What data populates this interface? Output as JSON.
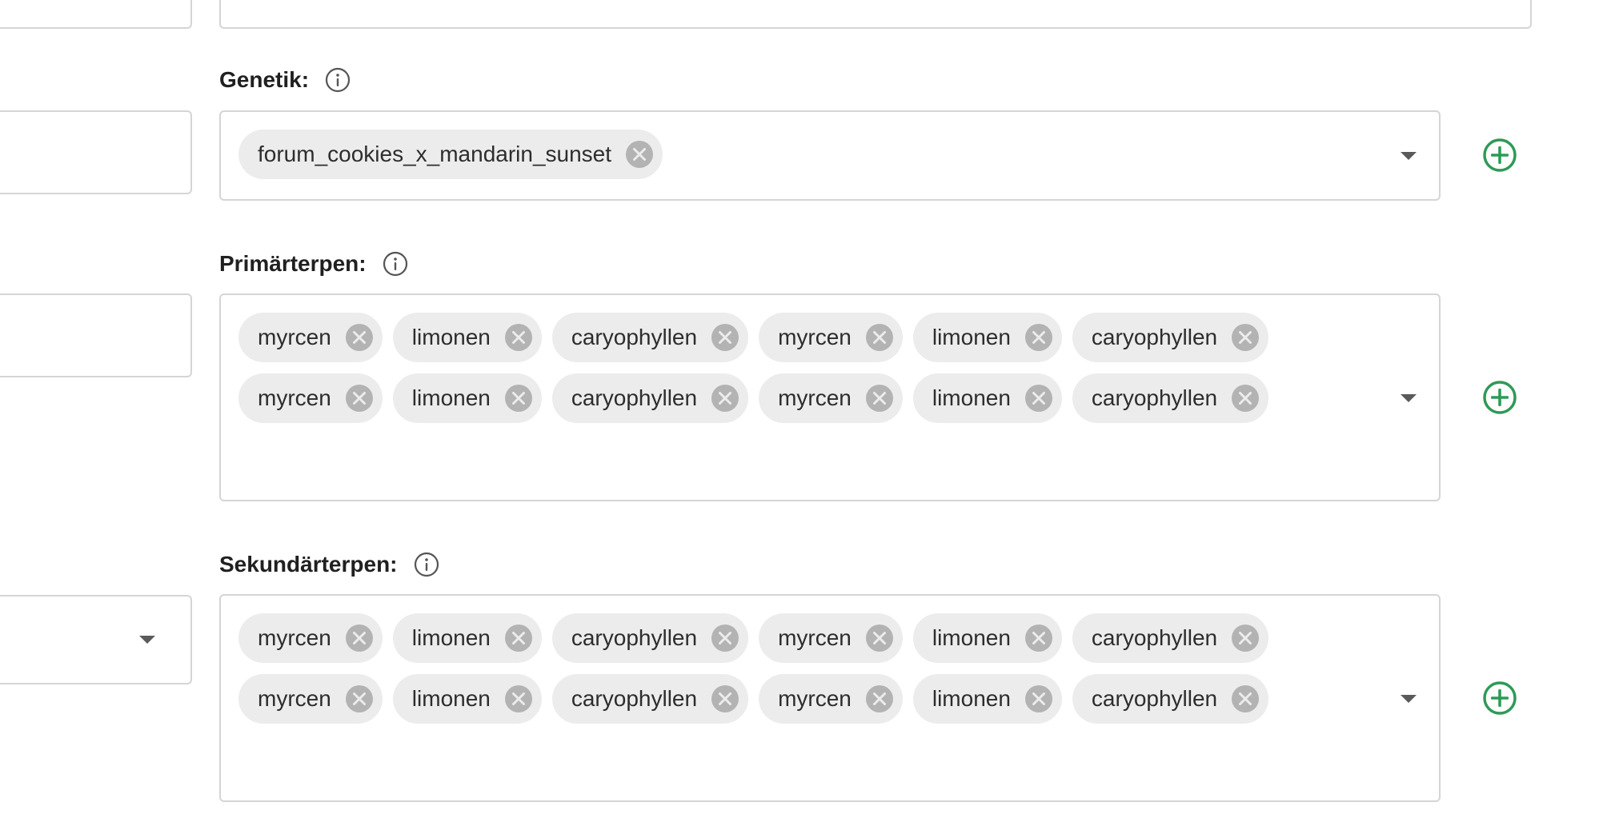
{
  "colors": {
    "accent_green": "#2e9a57",
    "chip_bg": "#ececec",
    "border": "#d5d5d5"
  },
  "sections": [
    {
      "label": "Genetik:",
      "tags": [
        "forum_cookies_x_mandarin_sunset"
      ]
    },
    {
      "label": "Primärterpen:",
      "tags": [
        "myrcen",
        "limonen",
        "caryophyllen",
        "myrcen",
        "limonen",
        "caryophyllen",
        "myrcen",
        "limonen",
        "caryophyllen",
        "myrcen",
        "limonen",
        "caryophyllen"
      ]
    },
    {
      "label": "Sekundärterpen:",
      "tags": [
        "myrcen",
        "limonen",
        "caryophyllen",
        "myrcen",
        "limonen",
        "caryophyllen",
        "myrcen",
        "limonen",
        "caryophyllen",
        "myrcen",
        "limonen",
        "caryophyllen"
      ]
    }
  ],
  "icons": {
    "info": "info-circle-icon",
    "remove": "close-circle-icon",
    "dropdown": "caret-down-icon",
    "add": "plus-circle-icon"
  }
}
